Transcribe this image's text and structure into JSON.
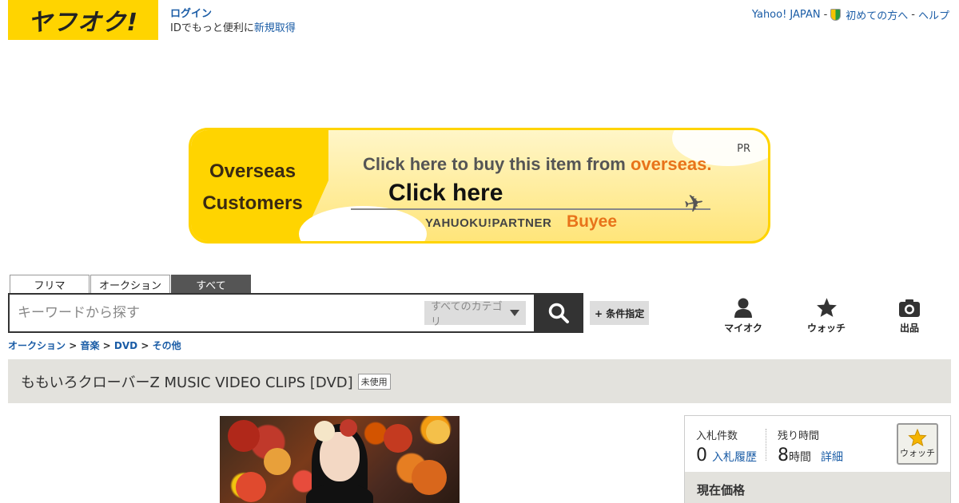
{
  "header": {
    "logo_text": "ヤフオク!",
    "login_label": "ログイン",
    "login_sub_prefix": "IDでもっと便利に",
    "register_label": "新規取得",
    "top_links": {
      "yahoo_japan": "Yahoo! JAPAN",
      "sep": "-",
      "beginner": "初めての方へ",
      "help": "ヘルプ"
    }
  },
  "banner": {
    "left_line1": "Overseas",
    "left_line2": "Customers",
    "headline_prefix": "Click here to buy this item from ",
    "headline_highlight": "overseas.",
    "cta": "Click here",
    "partner": "YAHUOKU!PARTNER",
    "brand": "Buyee",
    "pr": "PR"
  },
  "search": {
    "tabs": [
      "フリマ",
      "オークション",
      "すべて"
    ],
    "active_tab": "すべて",
    "placeholder": "キーワードから探す",
    "category": "すべてのカテゴリ",
    "detail_label": "+ 条件指定"
  },
  "utils": {
    "myauc": "マイオク",
    "watch": "ウォッチ",
    "sell": "出品"
  },
  "breadcrumb": {
    "items": [
      "オークション",
      "音楽",
      "DVD",
      "その他"
    ],
    "sep": ">"
  },
  "item": {
    "title": "ももいろクローバーZ MUSIC VIDEO CLIPS [DVD]",
    "condition": "未使用"
  },
  "panel": {
    "bids_label": "入札件数",
    "bids_value": "0",
    "bids_history": "入札履歴",
    "time_label": "残り時間",
    "time_value": "8",
    "time_unit": "時間",
    "time_detail": "詳細",
    "watch_label": "ウォッチ",
    "price_label": "現在価格"
  }
}
